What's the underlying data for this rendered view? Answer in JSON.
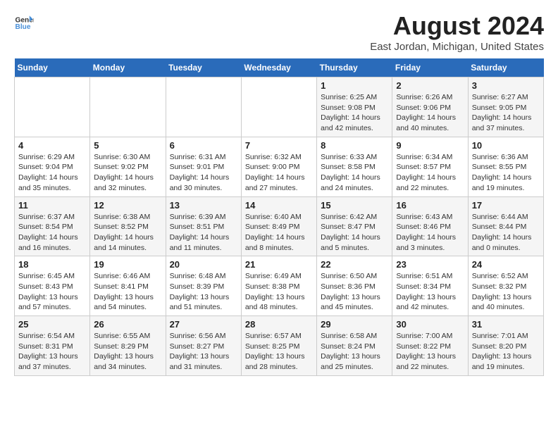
{
  "logo": {
    "line1": "General",
    "line2": "Blue"
  },
  "title": "August 2024",
  "subtitle": "East Jordan, Michigan, United States",
  "headers": [
    "Sunday",
    "Monday",
    "Tuesday",
    "Wednesday",
    "Thursday",
    "Friday",
    "Saturday"
  ],
  "weeks": [
    [
      {
        "day": "",
        "info": ""
      },
      {
        "day": "",
        "info": ""
      },
      {
        "day": "",
        "info": ""
      },
      {
        "day": "",
        "info": ""
      },
      {
        "day": "1",
        "info": "Sunrise: 6:25 AM\nSunset: 9:08 PM\nDaylight: 14 hours\nand 42 minutes."
      },
      {
        "day": "2",
        "info": "Sunrise: 6:26 AM\nSunset: 9:06 PM\nDaylight: 14 hours\nand 40 minutes."
      },
      {
        "day": "3",
        "info": "Sunrise: 6:27 AM\nSunset: 9:05 PM\nDaylight: 14 hours\nand 37 minutes."
      }
    ],
    [
      {
        "day": "4",
        "info": "Sunrise: 6:29 AM\nSunset: 9:04 PM\nDaylight: 14 hours\nand 35 minutes."
      },
      {
        "day": "5",
        "info": "Sunrise: 6:30 AM\nSunset: 9:02 PM\nDaylight: 14 hours\nand 32 minutes."
      },
      {
        "day": "6",
        "info": "Sunrise: 6:31 AM\nSunset: 9:01 PM\nDaylight: 14 hours\nand 30 minutes."
      },
      {
        "day": "7",
        "info": "Sunrise: 6:32 AM\nSunset: 9:00 PM\nDaylight: 14 hours\nand 27 minutes."
      },
      {
        "day": "8",
        "info": "Sunrise: 6:33 AM\nSunset: 8:58 PM\nDaylight: 14 hours\nand 24 minutes."
      },
      {
        "day": "9",
        "info": "Sunrise: 6:34 AM\nSunset: 8:57 PM\nDaylight: 14 hours\nand 22 minutes."
      },
      {
        "day": "10",
        "info": "Sunrise: 6:36 AM\nSunset: 8:55 PM\nDaylight: 14 hours\nand 19 minutes."
      }
    ],
    [
      {
        "day": "11",
        "info": "Sunrise: 6:37 AM\nSunset: 8:54 PM\nDaylight: 14 hours\nand 16 minutes."
      },
      {
        "day": "12",
        "info": "Sunrise: 6:38 AM\nSunset: 8:52 PM\nDaylight: 14 hours\nand 14 minutes."
      },
      {
        "day": "13",
        "info": "Sunrise: 6:39 AM\nSunset: 8:51 PM\nDaylight: 14 hours\nand 11 minutes."
      },
      {
        "day": "14",
        "info": "Sunrise: 6:40 AM\nSunset: 8:49 PM\nDaylight: 14 hours\nand 8 minutes."
      },
      {
        "day": "15",
        "info": "Sunrise: 6:42 AM\nSunset: 8:47 PM\nDaylight: 14 hours\nand 5 minutes."
      },
      {
        "day": "16",
        "info": "Sunrise: 6:43 AM\nSunset: 8:46 PM\nDaylight: 14 hours\nand 3 minutes."
      },
      {
        "day": "17",
        "info": "Sunrise: 6:44 AM\nSunset: 8:44 PM\nDaylight: 14 hours\nand 0 minutes."
      }
    ],
    [
      {
        "day": "18",
        "info": "Sunrise: 6:45 AM\nSunset: 8:43 PM\nDaylight: 13 hours\nand 57 minutes."
      },
      {
        "day": "19",
        "info": "Sunrise: 6:46 AM\nSunset: 8:41 PM\nDaylight: 13 hours\nand 54 minutes."
      },
      {
        "day": "20",
        "info": "Sunrise: 6:48 AM\nSunset: 8:39 PM\nDaylight: 13 hours\nand 51 minutes."
      },
      {
        "day": "21",
        "info": "Sunrise: 6:49 AM\nSunset: 8:38 PM\nDaylight: 13 hours\nand 48 minutes."
      },
      {
        "day": "22",
        "info": "Sunrise: 6:50 AM\nSunset: 8:36 PM\nDaylight: 13 hours\nand 45 minutes."
      },
      {
        "day": "23",
        "info": "Sunrise: 6:51 AM\nSunset: 8:34 PM\nDaylight: 13 hours\nand 42 minutes."
      },
      {
        "day": "24",
        "info": "Sunrise: 6:52 AM\nSunset: 8:32 PM\nDaylight: 13 hours\nand 40 minutes."
      }
    ],
    [
      {
        "day": "25",
        "info": "Sunrise: 6:54 AM\nSunset: 8:31 PM\nDaylight: 13 hours\nand 37 minutes."
      },
      {
        "day": "26",
        "info": "Sunrise: 6:55 AM\nSunset: 8:29 PM\nDaylight: 13 hours\nand 34 minutes."
      },
      {
        "day": "27",
        "info": "Sunrise: 6:56 AM\nSunset: 8:27 PM\nDaylight: 13 hours\nand 31 minutes."
      },
      {
        "day": "28",
        "info": "Sunrise: 6:57 AM\nSunset: 8:25 PM\nDaylight: 13 hours\nand 28 minutes."
      },
      {
        "day": "29",
        "info": "Sunrise: 6:58 AM\nSunset: 8:24 PM\nDaylight: 13 hours\nand 25 minutes."
      },
      {
        "day": "30",
        "info": "Sunrise: 7:00 AM\nSunset: 8:22 PM\nDaylight: 13 hours\nand 22 minutes."
      },
      {
        "day": "31",
        "info": "Sunrise: 7:01 AM\nSunset: 8:20 PM\nDaylight: 13 hours\nand 19 minutes."
      }
    ]
  ]
}
